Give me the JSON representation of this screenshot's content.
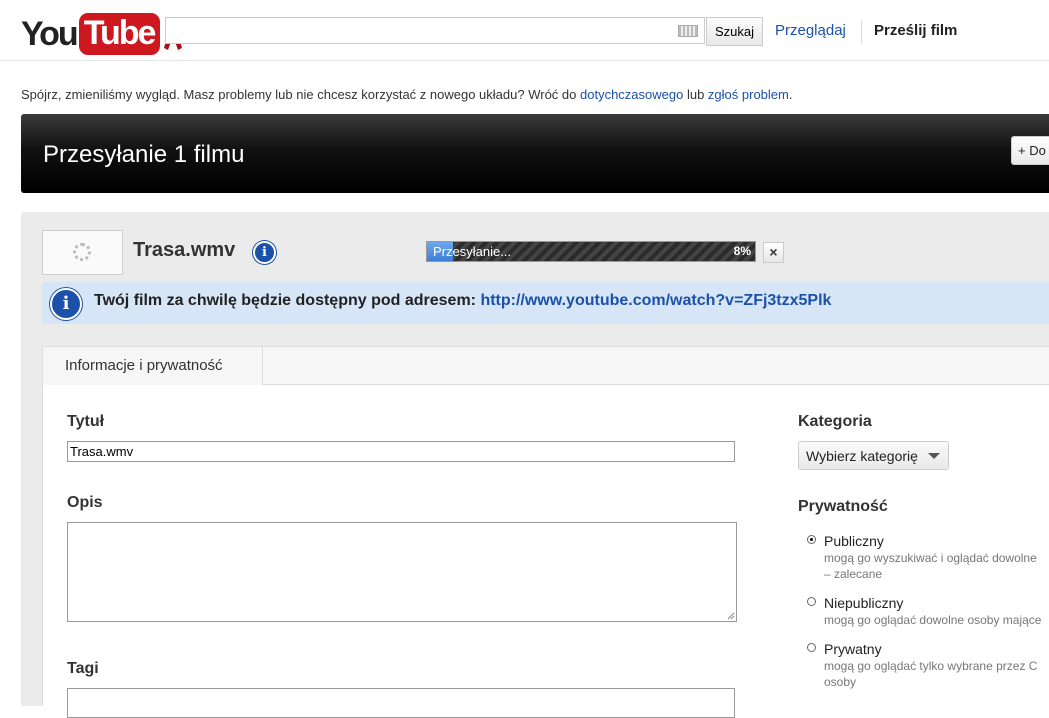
{
  "header": {
    "logo_you": "You",
    "logo_tube": "Tube",
    "search_button": "Szukaj",
    "nav_browse": "Przeglądaj",
    "nav_upload": "Prześlij film"
  },
  "notice": {
    "text": "Spójrz, zmieniliśmy wygląd. Masz problemy lub nie chcesz korzystać z nowego układu? Wróć do ",
    "link1": "dotychczasowego",
    "middle": " lub ",
    "link2": "zgłoś problem",
    "end": "."
  },
  "upload_bar": {
    "title": "Przesyłanie 1 filmu",
    "add_more": "+ Do"
  },
  "file": {
    "name": "Trasa.wmv",
    "progress_label": "Przesyłanie...",
    "progress_percent": "8%",
    "progress_value": 0.08,
    "cancel": "×"
  },
  "info_notice": {
    "text": "Twój film za chwilę będzie dostępny pod adresem: ",
    "url": "http://www.youtube.com/watch?v=ZFj3tzx5Plk"
  },
  "tabs": [
    {
      "label": "Informacje i prywatność"
    }
  ],
  "form": {
    "title_label": "Tytuł",
    "title_value": "Trasa.wmv",
    "description_label": "Opis",
    "tags_label": "Tagi",
    "category_label": "Kategoria",
    "category_value": "Wybierz kategorię",
    "privacy_label": "Prywatność",
    "privacy_options": [
      {
        "label": "Publiczny",
        "desc1": "mogą go wyszukiwać i oglądać dowolne",
        "desc2": "– zalecane",
        "checked": true
      },
      {
        "label": "Niepubliczny",
        "desc1": "mogą go oglądać dowolne osoby mające",
        "desc2": "",
        "checked": false
      },
      {
        "label": "Prywatny",
        "desc1": "mogą go oglądać tylko wybrane przez C",
        "desc2": "osoby",
        "checked": false
      }
    ]
  },
  "colors": {
    "accent": "#1c51a9",
    "brand_red": "#cc181e",
    "progress_blue": "#3c7ed6",
    "notice_bg": "#d6e6f7"
  }
}
